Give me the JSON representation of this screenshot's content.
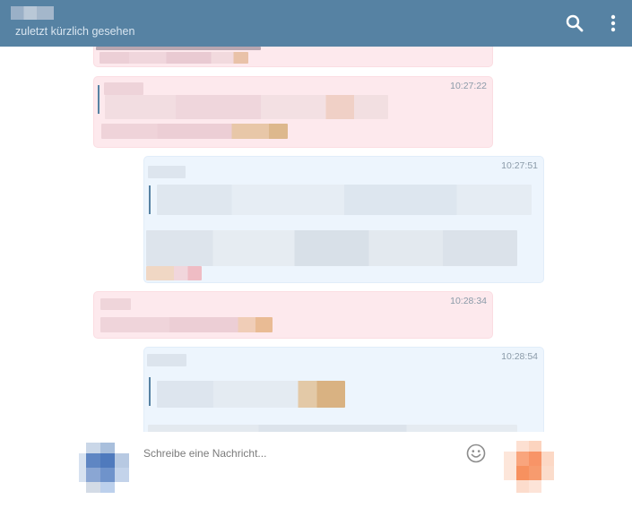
{
  "header": {
    "status": "zuletzt kürzlich gesehen",
    "search_icon": "search-icon",
    "menu_icon": "more-vertical-icon"
  },
  "messages": [
    {
      "time": ""
    },
    {
      "time": "10:27:22"
    },
    {
      "time": "10:27:51"
    },
    {
      "time": "10:28:34"
    },
    {
      "time": "10:28:54"
    }
  ],
  "composer": {
    "placeholder": "Schreibe eine Nachricht...",
    "emoji_icon": "smiley-icon"
  }
}
